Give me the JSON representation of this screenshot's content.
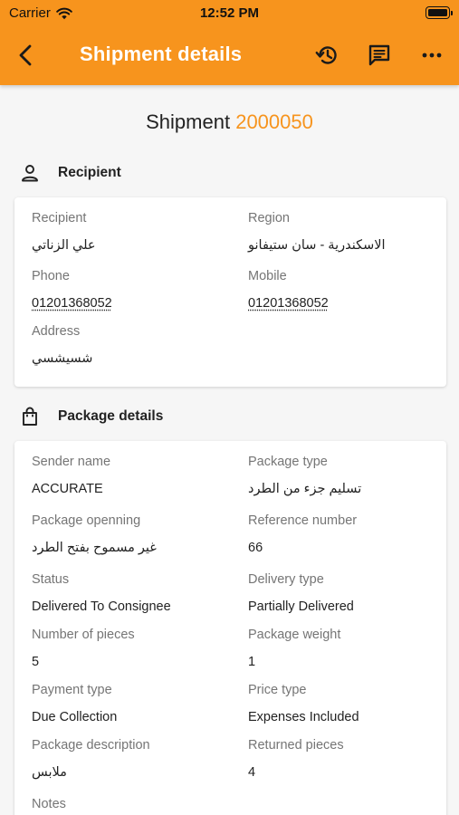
{
  "status_bar": {
    "carrier": "Carrier",
    "time": "12:52 PM"
  },
  "nav": {
    "title": "Shipment details",
    "icons": [
      "back-arrow-icon",
      "history-icon",
      "message-icon",
      "more-icon"
    ]
  },
  "shipment": {
    "prefix": "Shipment",
    "number": "2000050"
  },
  "recipient_section": {
    "title": "Recipient",
    "icon": "person-icon",
    "fields": {
      "recipient": {
        "label": "Recipient",
        "value": "علي الزناتي"
      },
      "region": {
        "label": "Region",
        "value": "الاسكندرية - سان ستيفانو"
      },
      "phone": {
        "label": "Phone",
        "value": "01201368052"
      },
      "mobile": {
        "label": "Mobile",
        "value": "01201368052"
      },
      "address": {
        "label": "Address",
        "value": "شسيشسي"
      }
    }
  },
  "package_section": {
    "title": "Package details",
    "icon": "shopping-bag-icon",
    "fields": {
      "sender_name": {
        "label": "Sender name",
        "value": "ACCURATE"
      },
      "package_type": {
        "label": "Package type",
        "value": "تسليم جزء من الطرد"
      },
      "package_opening": {
        "label": "Package openning",
        "value": "غير مسموح بفتح الطرد"
      },
      "reference_number": {
        "label": "Reference number",
        "value": "66"
      },
      "status": {
        "label": "Status",
        "value": "Delivered To Consignee"
      },
      "delivery_type": {
        "label": "Delivery type",
        "value": "Partially Delivered"
      },
      "number_of_pieces": {
        "label": "Number of pieces",
        "value": "5"
      },
      "package_weight": {
        "label": "Package weight",
        "value": "1"
      },
      "payment_type": {
        "label": "Payment type",
        "value": "Due Collection"
      },
      "price_type": {
        "label": "Price type",
        "value": "Expenses Included"
      },
      "package_description": {
        "label": "Package description",
        "value": "ملابس"
      },
      "returned_pieces": {
        "label": "Returned pieces",
        "value": "4"
      },
      "notes": {
        "label": "Notes",
        "value": ""
      }
    }
  },
  "colors": {
    "accent": "#f7941d",
    "label": "#757575",
    "text": "#222222",
    "background": "#f6f6f6",
    "card": "#ffffff"
  }
}
